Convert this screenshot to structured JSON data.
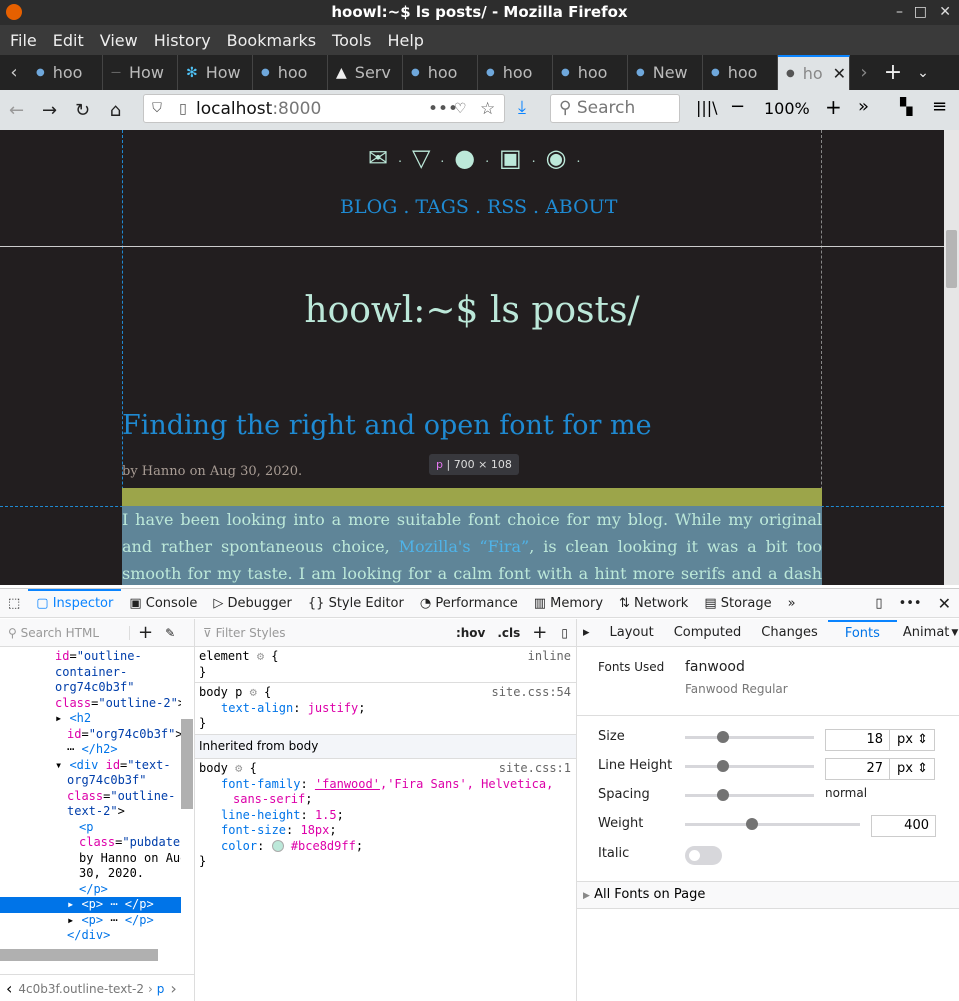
{
  "window": {
    "title": "hoowl:~$ ls posts/ - Mozilla Firefox",
    "min": "–",
    "max": "□",
    "close": "✕"
  },
  "menu": [
    "File",
    "Edit",
    "View",
    "History",
    "Bookmarks",
    "Tools",
    "Help"
  ],
  "tabs": [
    {
      "label": "hoo",
      "icon": "coffee-icon"
    },
    {
      "label": "How",
      "icon": "dash-icon"
    },
    {
      "label": "How",
      "icon": "snowflake-icon"
    },
    {
      "label": "hoo",
      "icon": "coffee-icon"
    },
    {
      "label": "Serv",
      "icon": "warning-icon"
    },
    {
      "label": "hoo",
      "icon": "coffee-icon"
    },
    {
      "label": "hoo",
      "icon": "coffee-icon"
    },
    {
      "label": "hoo",
      "icon": "coffee-icon"
    },
    {
      "label": "New",
      "icon": "coffee-icon"
    },
    {
      "label": "hoo",
      "icon": "coffee-icon"
    },
    {
      "label": "ho",
      "icon": "owl-icon",
      "active": true
    }
  ],
  "nav": {
    "url_host": "localhost",
    "url_port": ":8000",
    "search_placeholder": "Search",
    "zoom": "100%"
  },
  "site": {
    "nav_links": [
      "BLOG",
      "TAGS",
      "RSS",
      "ABOUT"
    ],
    "sep": ".",
    "heading": "hoowl:~$ ls posts/",
    "post_title": "Finding the right and open font for me",
    "byline": "by Hanno on Aug 30, 2020.",
    "tooltip_tag": "p",
    "tooltip_size": "700 × 108",
    "para_1": "I have been looking into a more suitable font choice for my blog. While my original and rather spontaneous choice, ",
    "para_link": "Mozilla's “Fira”",
    "para_2": ", is clean looking it was a bit too smooth for my taste. I am looking for a calm font with a hint more serifs and a dash of charm. And, of course, without any restrictive"
  },
  "devtools": {
    "tabs": [
      "Inspector",
      "Console",
      "Debugger",
      "Style Editor",
      "Performance",
      "Memory",
      "Network",
      "Storage"
    ],
    "search_html_placeholder": "Search HTML",
    "filter_styles_placeholder": "Filter Styles",
    "hov": ":hov",
    "cls": ".cls",
    "breadcrumb": "4c0b3f.outline-text-2",
    "breadcrumb_current": "p",
    "side_tabs": [
      "Layout",
      "Computed",
      "Changes",
      "Fonts",
      "Animat"
    ],
    "rules": {
      "element": "element",
      "inline": "inline",
      "bodyp": "body p",
      "bodyp_src": "site.css:54",
      "ta_prop": "text-align",
      "ta_val": "justify",
      "inherited": "Inherited from body",
      "body": "body",
      "body_src": "site.css:1",
      "ff_prop": "font-family",
      "ff_val1": "'fanwood'",
      "ff_val2": ",'Fira Sans', Helvetica,",
      "ff_val3": "sans-serif",
      "lh_prop": "line-height",
      "lh_val": "1.5",
      "fs_prop": "font-size",
      "fs_val": "18px",
      "color_prop": "color",
      "color_val": "#bce8d9ff",
      "swatch": "#bce8d9"
    },
    "fonts": {
      "used_label": "Fonts Used",
      "name": "fanwood",
      "full": "Fanwood Regular",
      "size_label": "Size",
      "size": "18",
      "unit": "px",
      "lh_label": "Line Height",
      "lh": "27",
      "spacing_label": "Spacing",
      "spacing": "normal",
      "weight_label": "Weight",
      "weight": "400",
      "italic_label": "Italic",
      "italic": false,
      "all_fonts": "All Fonts on Page"
    }
  },
  "colors": {
    "accent": "#0a84ff",
    "link": "#1f8ad2",
    "text": "#bce8d9",
    "bg": "#221e1f",
    "margin_highlight": "#9ca54a",
    "content_highlight": "#5f8598"
  }
}
